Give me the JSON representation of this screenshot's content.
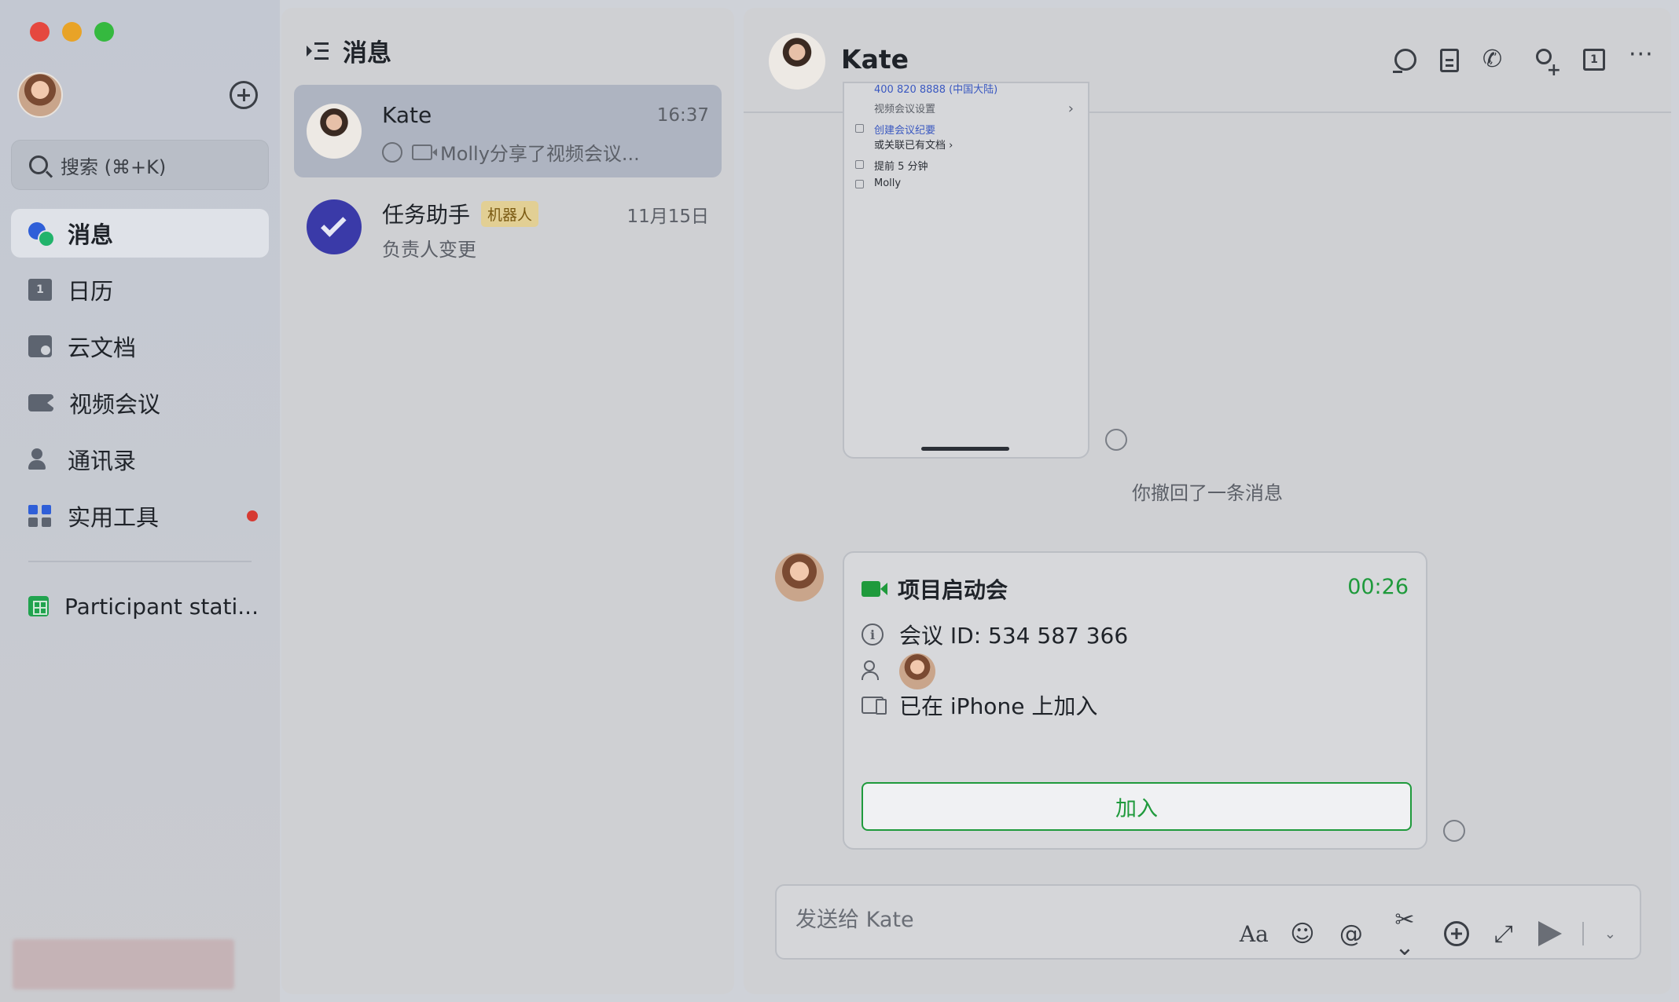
{
  "sidebar": {
    "search_placeholder": "搜索 (⌘+K)",
    "items": [
      {
        "label": "消息",
        "icon": "chat-icon",
        "active": true
      },
      {
        "label": "日历",
        "icon": "calendar-icon"
      },
      {
        "label": "云文档",
        "icon": "docs-icon"
      },
      {
        "label": "视频会议",
        "icon": "video-icon"
      },
      {
        "label": "通讯录",
        "icon": "contacts-icon"
      },
      {
        "label": "实用工具",
        "icon": "tools-icon",
        "badge_color": "#d63a32"
      }
    ],
    "pinned": {
      "label": "Participant stati...",
      "icon": "sheet-icon"
    }
  },
  "list": {
    "title": "消息",
    "conversations": [
      {
        "name": "Kate",
        "time": "16:37",
        "preview": "Molly分享了视频会议...",
        "active": true
      },
      {
        "name": "任务助手",
        "badge": "机器人",
        "time": "11月15日",
        "preview": "负责人变更"
      }
    ]
  },
  "chat": {
    "name": "Kate",
    "image_message": {
      "lines": [
        "400 820 8888 (中国大陆)",
        "视频会议设置",
        "创建会议纪要",
        "或关联已有文档 ›",
        "提前 5 分钟",
        "Molly"
      ],
      "chevron": "›"
    },
    "system_note": "你撤回了一条消息",
    "meeting": {
      "title": "项目启动会",
      "timer": "00:26",
      "id_line": "会议 ID: 534 587 366",
      "device_line": "已在 iPhone 上加入",
      "join_label": "加入"
    },
    "composer": {
      "placeholder": "发送给 Kate",
      "font_tool": "Aa",
      "emoji_tool": "☺",
      "mention_tool": "@",
      "scissor_tool": "✂⌄",
      "expand_tool": "⤢",
      "send_caret": "⌄"
    }
  },
  "colors": {
    "accent_green": "#1f9a3c",
    "brand_blue": "#2f5fd8",
    "alert_red": "#d63a32"
  }
}
